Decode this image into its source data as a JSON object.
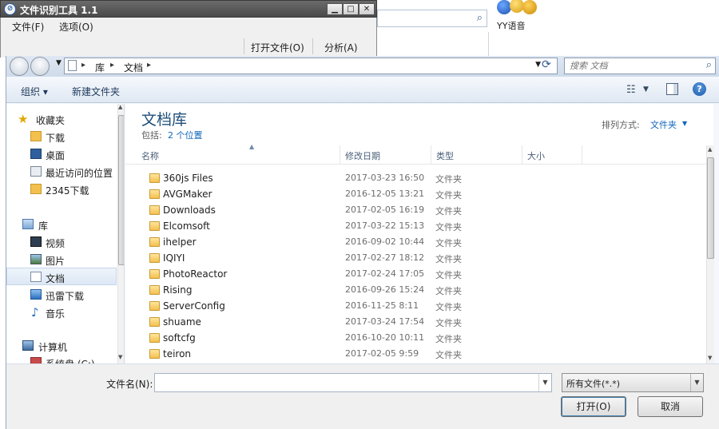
{
  "bg_app": {
    "title": "文件识别工具 1.1",
    "icon_glyph": "⊘",
    "ctrl_min": "▁",
    "ctrl_max": "□",
    "ctrl_close": "✕",
    "menu": [
      "文件(F)",
      "选项(O)"
    ],
    "toolbar": [
      "打开文件(O)",
      "分析(A)"
    ]
  },
  "desktop": {
    "yy_label": "YY语音"
  },
  "dialog": {
    "address": {
      "crumbs": [
        "库",
        "文档"
      ],
      "separator": "▸"
    },
    "search": {
      "placeholder": "搜索 文档"
    },
    "commands": {
      "organize": "组织 ▾",
      "new_folder": "新建文件夹"
    },
    "icons": {
      "view": "☷",
      "help": "?"
    },
    "nav": [
      {
        "label": "收藏夹",
        "icon": "star-icon"
      },
      {
        "label": "下载",
        "icon": "download-folder-icon"
      },
      {
        "label": "桌面",
        "icon": "desktop-icon"
      },
      {
        "label": "最近访问的位置",
        "icon": "recent-places-icon"
      },
      {
        "label": "2345下载",
        "icon": "folder-icon"
      },
      {
        "label": "库",
        "icon": "library-icon"
      },
      {
        "label": "视频",
        "icon": "video-icon"
      },
      {
        "label": "图片",
        "icon": "pictures-icon"
      },
      {
        "label": "文档",
        "icon": "documents-icon",
        "selected": true
      },
      {
        "label": "迅雷下载",
        "icon": "thunder-download-icon"
      },
      {
        "label": "音乐",
        "icon": "music-icon"
      },
      {
        "label": "计算机",
        "icon": "computer-icon"
      },
      {
        "label": "系统盘 (C:)",
        "icon": "drive-icon"
      }
    ],
    "library": {
      "title": "文档库",
      "includes_label": "包括:",
      "includes_count": "2 个位置",
      "arrange_label": "排列方式:",
      "arrange_value": "文件夹"
    },
    "columns": [
      "名称",
      "修改日期",
      "类型",
      "大小"
    ],
    "files": [
      {
        "name": "360js Files",
        "date": "2017-03-23 16:50",
        "type": "文件夹"
      },
      {
        "name": "AVGMaker",
        "date": "2016-12-05 13:21",
        "type": "文件夹"
      },
      {
        "name": "Downloads",
        "date": "2017-02-05 16:19",
        "type": "文件夹"
      },
      {
        "name": "Elcomsoft",
        "date": "2017-03-22 15:13",
        "type": "文件夹"
      },
      {
        "name": "ihelper",
        "date": "2016-09-02 10:44",
        "type": "文件夹"
      },
      {
        "name": "IQIYI",
        "date": "2017-02-27 18:12",
        "type": "文件夹"
      },
      {
        "name": "PhotoReactor",
        "date": "2017-02-24 17:05",
        "type": "文件夹"
      },
      {
        "name": "Rising",
        "date": "2016-09-26 15:24",
        "type": "文件夹"
      },
      {
        "name": "ServerConfig",
        "date": "2016-11-25 8:11",
        "type": "文件夹"
      },
      {
        "name": "shuame",
        "date": "2017-03-24 17:54",
        "type": "文件夹"
      },
      {
        "name": "softcfg",
        "date": "2016-10-20 10:11",
        "type": "文件夹"
      },
      {
        "name": "teiron",
        "date": "2017-02-05 9:59",
        "type": "文件夹"
      }
    ],
    "filename": {
      "label": "文件名(N):",
      "value": ""
    },
    "filetype": {
      "value": "所有文件(*.*)"
    },
    "buttons": {
      "open": "打开(O)",
      "cancel": "取消"
    }
  },
  "colors": {
    "accent": "#1166bb",
    "title_blue": "#1e4e79",
    "folder": "#f3c04e"
  }
}
